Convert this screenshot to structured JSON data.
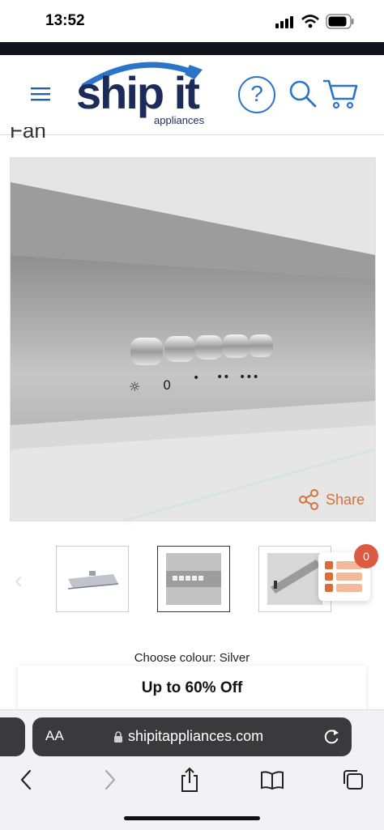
{
  "status_bar": {
    "time": "13:52"
  },
  "header": {
    "logo_main": "ship it",
    "logo_sub": "appliances",
    "help_glyph": "?"
  },
  "page": {
    "title_fragment": "Fan"
  },
  "hero": {
    "share_label": "Share",
    "knob_symbols": [
      "☼",
      "0",
      "•",
      "••",
      "•••"
    ]
  },
  "thumbnails": {
    "prev_glyph": "‹"
  },
  "reward_widget": {
    "count": "0"
  },
  "product": {
    "colour_label": "Choose colour: Silver",
    "promo_text": "Up to 60% Off"
  },
  "safari": {
    "aa_label": "AA",
    "url": "shipitappliances.com"
  },
  "colors": {
    "brand_navy": "#1c2b59",
    "brand_blue": "#2b75c9",
    "accent_orange": "#d9703b",
    "badge_red": "#dc5a41"
  }
}
